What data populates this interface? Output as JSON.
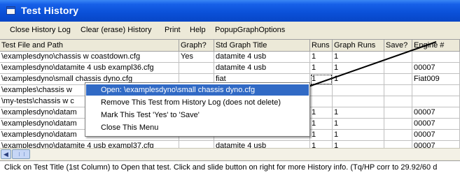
{
  "window": {
    "title": "Test History"
  },
  "menu": [
    {
      "label": "Close History Log"
    },
    {
      "label": "Clear (erase) History"
    },
    {
      "label": "Print"
    },
    {
      "label": "Help"
    },
    {
      "label": "PopupGraphOptions"
    }
  ],
  "grid": {
    "columns": [
      "Test File and Path",
      "Graph?",
      "Std Graph Title",
      "Runs",
      "Graph Runs",
      "Save?",
      "Engine #"
    ],
    "rows": [
      [
        "\\examplesdyno\\chassis w coastdown.cfg",
        "Yes",
        "datamite 4 usb",
        "1",
        "1",
        "",
        ""
      ],
      [
        "\\examplesdyno\\datamite 4 usb exampl36.cfg",
        "",
        "datamite 4 usb",
        "1",
        "1",
        "",
        "00007"
      ],
      [
        "\\examplesdyno\\small chassis dyno.cfg",
        "",
        "fiat",
        "1",
        "1",
        "",
        "Fiat009"
      ],
      [
        "\\examples\\chassis w",
        "",
        "",
        "",
        "",
        "",
        ""
      ],
      [
        "\\my-tests\\chassis w c",
        "",
        "",
        "",
        "",
        "",
        ""
      ],
      [
        "\\examplesdyno\\datam",
        "",
        "",
        "1",
        "1",
        "",
        "00007"
      ],
      [
        "\\examplesdyno\\datam",
        "",
        "",
        "1",
        "1",
        "",
        "00007"
      ],
      [
        "\\examplesdyno\\datam",
        "",
        "",
        "1",
        "1",
        "",
        "00007"
      ],
      [
        "\\examplesdyno\\datamite 4 usb exampl37.cfg",
        "",
        "datamite 4 usb",
        "1",
        "1",
        "",
        "00007"
      ]
    ]
  },
  "popup_menu": [
    {
      "label": "Open: \\examplesdyno\\small chassis dyno.cfg",
      "selected": true
    },
    {
      "label": "Remove This Test from History Log (does not delete)"
    },
    {
      "label": "Mark This Test 'Yes' to 'Save'"
    },
    {
      "label": "Close This Menu"
    }
  ],
  "status": {
    "text": "Click on Test Title (1st Column) to Open that test.  Click and slide button on right for more History info. (Tq/HP corr to 29.92/60 d"
  },
  "colors": {
    "titlebar": "#0a50d8",
    "selection": "#316ac5",
    "window_bg": "#ece9d8"
  },
  "icons": {
    "window": "app-window-icon",
    "scroll_left": "arrow-left-icon",
    "scroll_thumb": "scroll-thumb-grip"
  }
}
